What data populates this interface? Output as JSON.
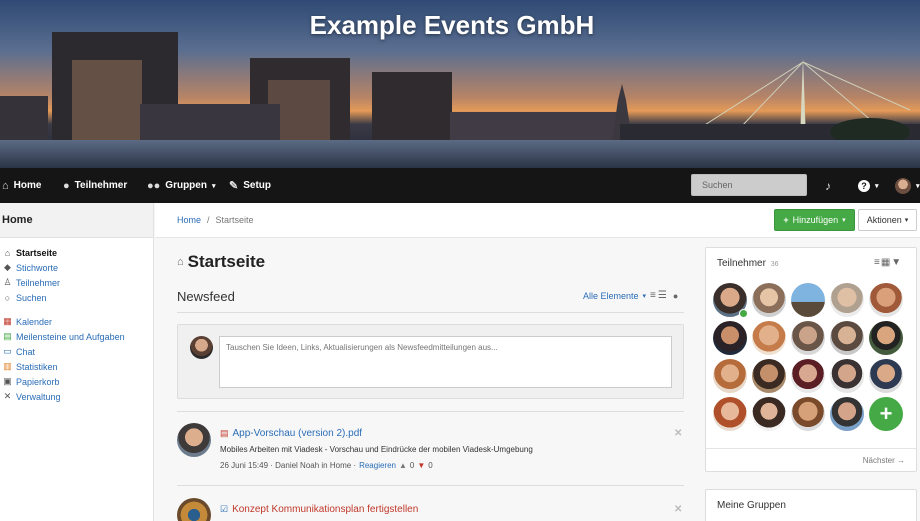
{
  "banner": {
    "title": "Example Events GmbH"
  },
  "navbar": {
    "items": [
      {
        "label": "Home",
        "icon": "home-icon"
      },
      {
        "label": "Teilnehmer",
        "icon": "user-icon"
      },
      {
        "label": "Gruppen",
        "icon": "group-icon"
      },
      {
        "label": "Setup",
        "icon": "wrench-icon"
      }
    ],
    "search_placeholder": "Suchen",
    "help_label": "?"
  },
  "sidebar": {
    "heading": "Home",
    "items": [
      {
        "label": "Startseite",
        "icon": "home-icon"
      },
      {
        "label": "Stichworte",
        "icon": "tag-icon"
      },
      {
        "label": "Teilnehmer",
        "icon": "person-icon"
      },
      {
        "label": "Suchen",
        "icon": "magnifier-icon"
      },
      {
        "label": "Kalender",
        "icon": "calendar-icon"
      },
      {
        "label": "Meilensteine und Aufgaben",
        "icon": "tasks-icon"
      },
      {
        "label": "Chat",
        "icon": "chat-icon"
      },
      {
        "label": "Statistiken",
        "icon": "chart-icon"
      },
      {
        "label": "Papierkorb",
        "icon": "trash-icon"
      },
      {
        "label": "Verwaltung",
        "icon": "tools-icon"
      }
    ]
  },
  "breadcrumb": {
    "home": "Home",
    "separator": "/",
    "current": "Startseite"
  },
  "toolbar": {
    "add_label": "Hinzufügen",
    "actions_label": "Aktionen"
  },
  "main": {
    "title": "Startseite",
    "newsfeed_label": "Newsfeed",
    "filter_label": "Alle Elemente",
    "composer_placeholder": "Tauschen Sie Ideen, Links, Aktualisierungen als Newsfeedmitteilungen aus...",
    "feed": [
      {
        "title": "App-Vorschau (version 2).pdf",
        "description": "Mobiles Arbeiten mit Viadesk - Vorschau und Eindrücke der mobilen Viadesk-Umgebung",
        "meta": "26 Juni 15:49 · Daniel Noah in Home ·",
        "react": "Reagieren",
        "likes": "0",
        "dislikes": "0"
      },
      {
        "title": "Konzept Kommunikationsplan fertigstellen"
      }
    ]
  },
  "participants_panel": {
    "title": "Teilnehmer",
    "count": "36",
    "next_label": "Nächster →"
  },
  "groups_panel": {
    "title": "Meine Gruppen"
  },
  "colors": {
    "accent": "#2a6db7",
    "success": "#45a945",
    "navbar": "#151515"
  }
}
